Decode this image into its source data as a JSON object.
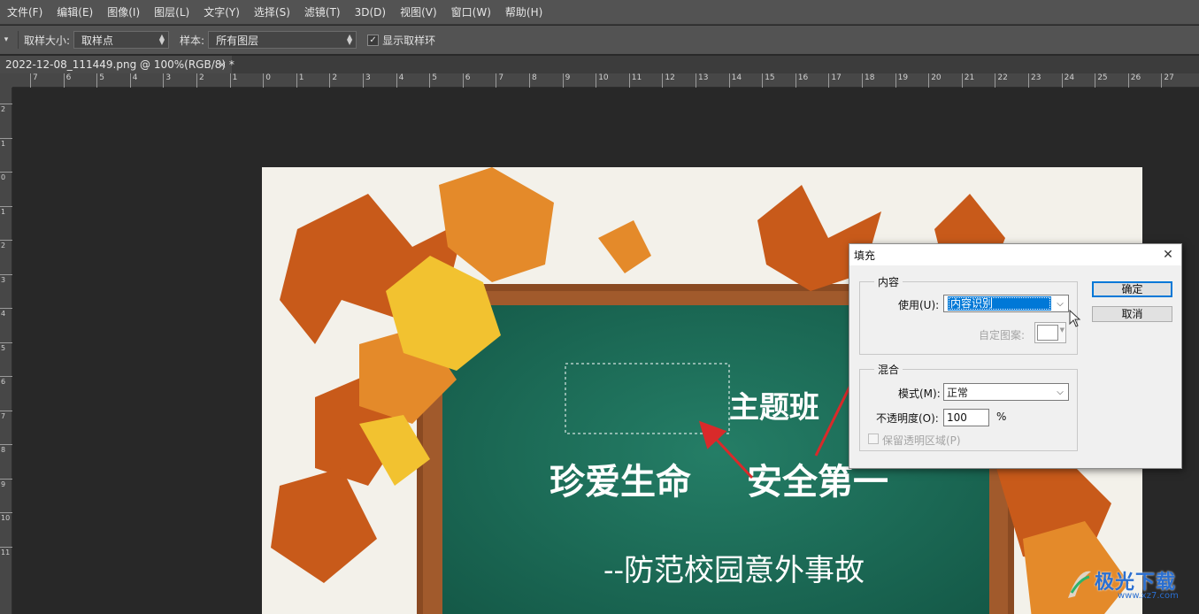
{
  "menubar": {
    "items": [
      "文件(F)",
      "编辑(E)",
      "图像(I)",
      "图层(L)",
      "文字(Y)",
      "选择(S)",
      "滤镜(T)",
      "3D(D)",
      "视图(V)",
      "窗口(W)",
      "帮助(H)"
    ]
  },
  "options": {
    "sample_size_label": "取样大小:",
    "sample_size_value": "取样点",
    "sample_label": "样本:",
    "sample_value": "所有图层",
    "show_ring_label": "显示取样环",
    "show_ring_checked": true
  },
  "document": {
    "tab_title": "2022-12-08_111449.png @ 100%(RGB/8) *",
    "close_glyph": "×"
  },
  "rulers": {
    "top_labels": [
      "7",
      "6",
      "5",
      "4",
      "3",
      "2",
      "1",
      "0",
      "1",
      "2",
      "3",
      "4",
      "5",
      "6",
      "7",
      "8",
      "9",
      "10",
      "11",
      "12",
      "13",
      "14",
      "15",
      "16",
      "17",
      "18",
      "19",
      "20",
      "21",
      "22",
      "23",
      "24",
      "25",
      "26",
      "27"
    ],
    "left_labels": [
      "2",
      "1",
      "0",
      "1",
      "2",
      "3",
      "4",
      "5",
      "6",
      "7",
      "8",
      "9",
      "10",
      "11"
    ]
  },
  "artwork": {
    "title_small": "主题班",
    "title_main_left": "珍爱生命",
    "title_main_right": "安全第一",
    "subtitle": "--防范校园意外事故",
    "board_color": "#1c6b57",
    "frame_color": "#8a4a22"
  },
  "dialog": {
    "title": "填充",
    "close_glyph": "✕",
    "content_group": "内容",
    "use_label": "使用(U):",
    "use_value": "内容识别",
    "custom_pattern_label": "自定图案:",
    "blend_group": "混合",
    "mode_label": "模式(M):",
    "mode_value": "正常",
    "opacity_label": "不透明度(O):",
    "opacity_value": "100",
    "opacity_unit": "%",
    "preserve_label": "保留透明区域(P)",
    "ok_label": "确定",
    "cancel_label": "取消"
  },
  "watermark": {
    "text": "极光下载",
    "url": "www.xz7.com"
  },
  "colors": {
    "accent": "#0078d7",
    "annotation_arrow": "#d92a2a"
  }
}
